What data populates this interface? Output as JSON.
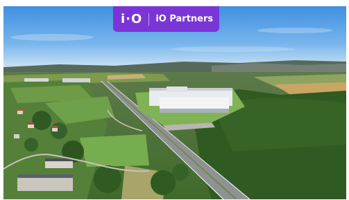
{
  "badge": {
    "logo_text": "i·O",
    "brand_name": "iO Partners",
    "background_color": "#7a35d6"
  },
  "photo": {
    "subject": "aerial-landscape"
  }
}
